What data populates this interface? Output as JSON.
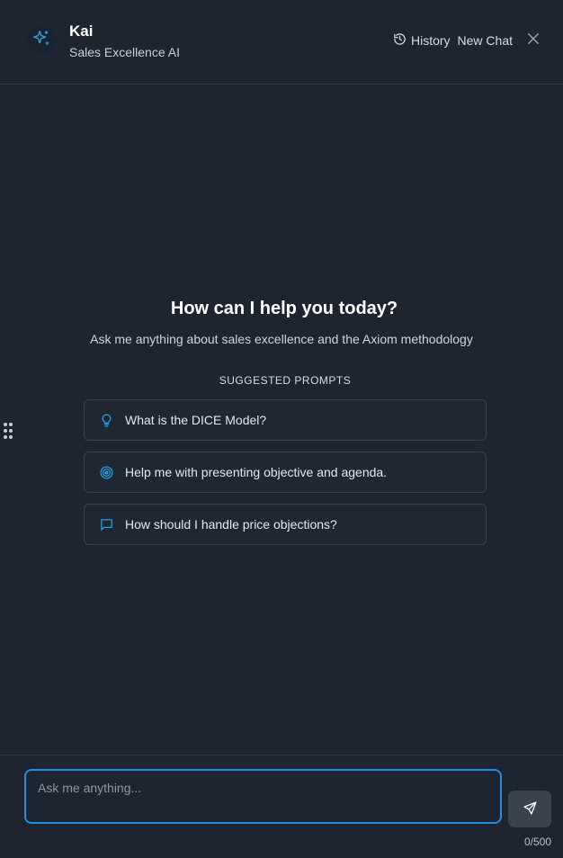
{
  "header": {
    "title": "Kai",
    "subtitle": "Sales Excellence AI",
    "history_label": "History",
    "new_chat_label": "New Chat",
    "avatar_icon": "sparkles-icon",
    "accent_color": "#2d9cdb"
  },
  "welcome": {
    "heading": "How can I help you today?",
    "description": "Ask me anything about sales excellence and the Axiom methodology"
  },
  "suggested": {
    "label": "SUGGESTED PROMPTS",
    "prompts": [
      {
        "icon": "lightbulb-icon",
        "text": "What is the DICE Model?"
      },
      {
        "icon": "target-icon",
        "text": "Help me with presenting objective and agenda."
      },
      {
        "icon": "message-square-icon",
        "text": "How should I handle price objections?"
      }
    ]
  },
  "composer": {
    "placeholder": "Ask me anything...",
    "value": "",
    "counter": "0/500",
    "focus_color": "#1e8ee6"
  }
}
